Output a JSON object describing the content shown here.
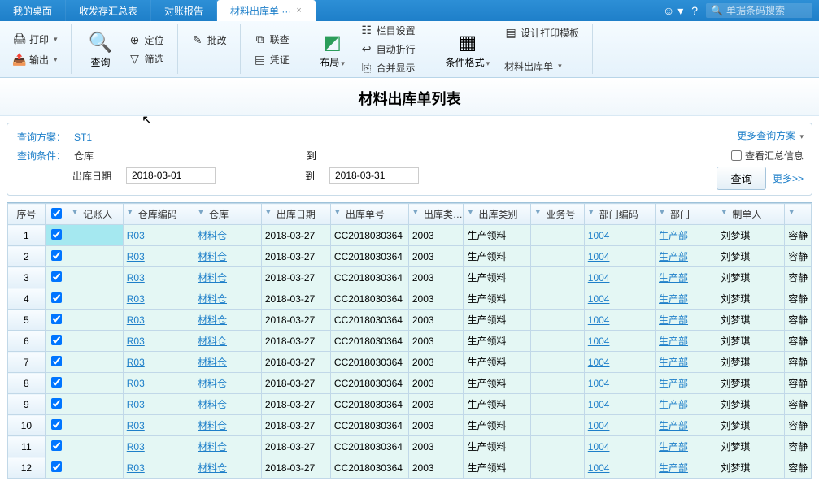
{
  "tabs": {
    "t0": "我的桌面",
    "t1": "收发存汇总表",
    "t2": "对账报告",
    "t3": "材料出库单 ···"
  },
  "close_x": "×",
  "search_placeholder": "单据条码搜索",
  "ribbon": {
    "print": "打印",
    "export": "输出",
    "query_big": "查询",
    "locate": "定位",
    "filter": "筛选",
    "batch": "批改",
    "cross": "联查",
    "voucher": "凭证",
    "layout": "布局",
    "colset": "栏目设置",
    "autowrap": "自动折行",
    "mergeshow": "合并显示",
    "cond": "条件格式",
    "tmpl": "设计打印模板",
    "doc": "材料出库单"
  },
  "page_title": "材料出库单列表",
  "query": {
    "scheme_lbl": "查询方案：",
    "scheme_val": "ST1",
    "cond_lbl": "查询条件：",
    "wh_lbl": "仓库",
    "to_lbl": "到",
    "date_lbl": "出库日期",
    "from_date": "2018-03-01",
    "to_date": "2018-03-31",
    "more_scheme": "更多查询方案",
    "summary_chk": "查看汇总信息",
    "btn_query": "查询",
    "more": "更多>>"
  },
  "cols": {
    "seq": "序号",
    "accountant": "记账人",
    "whcode": "仓库编码",
    "wh": "仓库",
    "date": "出库日期",
    "docno": "出库单号",
    "class": "出库类…",
    "category": "出库类别",
    "bizno": "业务号",
    "deptcode": "部门编码",
    "dept": "部门",
    "maker": "制单人"
  },
  "rows": [
    {
      "i": "1",
      "wh_code": "R03",
      "wh": "材料仓",
      "date": "2018-03-27",
      "doc": "CC2018030364",
      "cls": "2003",
      "cat": "生产领料",
      "dept_code": "1004",
      "dept": "生产部",
      "maker": "刘梦琪",
      "aud": "容静"
    },
    {
      "i": "2",
      "wh_code": "R03",
      "wh": "材料仓",
      "date": "2018-03-27",
      "doc": "CC2018030364",
      "cls": "2003",
      "cat": "生产领料",
      "dept_code": "1004",
      "dept": "生产部",
      "maker": "刘梦琪",
      "aud": "容静"
    },
    {
      "i": "3",
      "wh_code": "R03",
      "wh": "材料仓",
      "date": "2018-03-27",
      "doc": "CC2018030364",
      "cls": "2003",
      "cat": "生产领料",
      "dept_code": "1004",
      "dept": "生产部",
      "maker": "刘梦琪",
      "aud": "容静"
    },
    {
      "i": "4",
      "wh_code": "R03",
      "wh": "材料仓",
      "date": "2018-03-27",
      "doc": "CC2018030364",
      "cls": "2003",
      "cat": "生产领料",
      "dept_code": "1004",
      "dept": "生产部",
      "maker": "刘梦琪",
      "aud": "容静"
    },
    {
      "i": "5",
      "wh_code": "R03",
      "wh": "材料仓",
      "date": "2018-03-27",
      "doc": "CC2018030364",
      "cls": "2003",
      "cat": "生产领料",
      "dept_code": "1004",
      "dept": "生产部",
      "maker": "刘梦琪",
      "aud": "容静"
    },
    {
      "i": "6",
      "wh_code": "R03",
      "wh": "材料仓",
      "date": "2018-03-27",
      "doc": "CC2018030364",
      "cls": "2003",
      "cat": "生产领料",
      "dept_code": "1004",
      "dept": "生产部",
      "maker": "刘梦琪",
      "aud": "容静"
    },
    {
      "i": "7",
      "wh_code": "R03",
      "wh": "材料仓",
      "date": "2018-03-27",
      "doc": "CC2018030364",
      "cls": "2003",
      "cat": "生产领料",
      "dept_code": "1004",
      "dept": "生产部",
      "maker": "刘梦琪",
      "aud": "容静"
    },
    {
      "i": "8",
      "wh_code": "R03",
      "wh": "材料仓",
      "date": "2018-03-27",
      "doc": "CC2018030364",
      "cls": "2003",
      "cat": "生产领料",
      "dept_code": "1004",
      "dept": "生产部",
      "maker": "刘梦琪",
      "aud": "容静"
    },
    {
      "i": "9",
      "wh_code": "R03",
      "wh": "材料仓",
      "date": "2018-03-27",
      "doc": "CC2018030364",
      "cls": "2003",
      "cat": "生产领料",
      "dept_code": "1004",
      "dept": "生产部",
      "maker": "刘梦琪",
      "aud": "容静"
    },
    {
      "i": "10",
      "wh_code": "R03",
      "wh": "材料仓",
      "date": "2018-03-27",
      "doc": "CC2018030364",
      "cls": "2003",
      "cat": "生产领料",
      "dept_code": "1004",
      "dept": "生产部",
      "maker": "刘梦琪",
      "aud": "容静"
    },
    {
      "i": "11",
      "wh_code": "R03",
      "wh": "材料仓",
      "date": "2018-03-27",
      "doc": "CC2018030364",
      "cls": "2003",
      "cat": "生产领料",
      "dept_code": "1004",
      "dept": "生产部",
      "maker": "刘梦琪",
      "aud": "容静"
    },
    {
      "i": "12",
      "wh_code": "R03",
      "wh": "材料仓",
      "date": "2018-03-27",
      "doc": "CC2018030364",
      "cls": "2003",
      "cat": "生产领料",
      "dept_code": "1004",
      "dept": "生产部",
      "maker": "刘梦琪",
      "aud": "容静"
    }
  ]
}
